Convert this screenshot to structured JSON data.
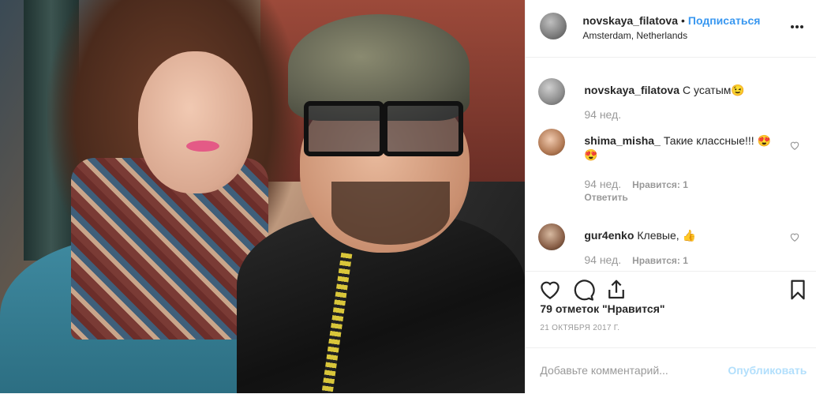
{
  "post": {
    "username": "novskaya_filatova",
    "dot": "•",
    "follow_label": "Подписаться",
    "location": "Amsterdam, Netherlands"
  },
  "comments": [
    {
      "user": "novskaya_filatova",
      "text": "С усатым😉",
      "age": "94 нед."
    },
    {
      "user": "shima_misha_",
      "text": "Такие классные!!! 😍😍",
      "age": "94 нед.",
      "likes": "Нравится: 1",
      "reply": "Ответить"
    },
    {
      "user": "gur4enko",
      "text": "Клевые, 👍",
      "age": "94 нед.",
      "likes": "Нравится: 1"
    }
  ],
  "likes_text": "79 отметок \"Нравится\"",
  "date_text": "21 ОКТЯБРЯ 2017 Г.",
  "add_comment": {
    "placeholder": "Добавьте комментарий...",
    "publish_label": "Опубликовать"
  },
  "icons": [
    "more-icon",
    "heart-icon",
    "comment-icon",
    "share-icon",
    "bookmark-icon"
  ],
  "colors": {
    "accent": "#3897f0",
    "muted": "#999999",
    "publish_disabled": "#b2dffc"
  }
}
